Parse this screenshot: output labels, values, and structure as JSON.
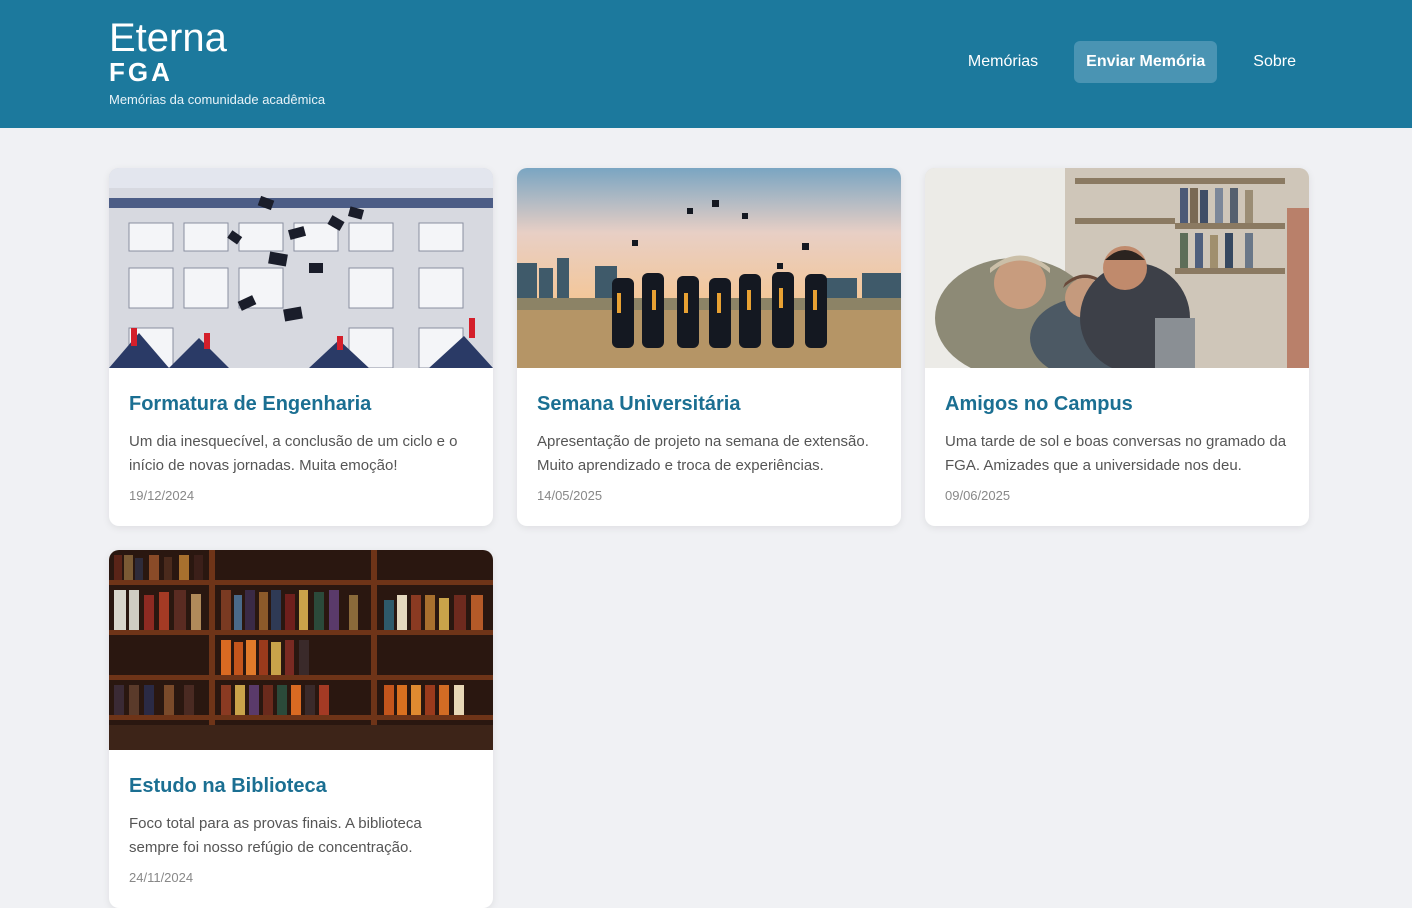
{
  "brand": {
    "title": "Eterna",
    "subtitle": "FGA",
    "tagline": "Memórias da comunidade acadêmica"
  },
  "nav": {
    "items": [
      {
        "label": "Memórias",
        "active": false
      },
      {
        "label": "Enviar Memória",
        "active": true
      },
      {
        "label": "Sobre",
        "active": false
      }
    ]
  },
  "colors": {
    "header": "#1c799d",
    "accent": "#1b6f92",
    "background": "#f0f1f4"
  },
  "cards": [
    {
      "title": "Formatura de Engenharia",
      "text": "Um dia inesquecível, a conclusão de um ciclo e o início de novas jornadas. Muita emoção!",
      "date": "19/12/2024",
      "image": "graduation-caps-building-photo"
    },
    {
      "title": "Semana Universitária",
      "text": "Apresentação de projeto na semana de extensão. Muito aprendizado e troca de experiências.",
      "date": "14/05/2025",
      "image": "graduates-sunset-photo"
    },
    {
      "title": "Amigos no Campus",
      "text": "Uma tarde de sol e boas conversas no gramado da FGA. Amizades que a universidade nos deu.",
      "date": "09/06/2025",
      "image": "friends-laptop-library-photo"
    },
    {
      "title": "Estudo na Biblioteca",
      "text": "Foco total para as provas finais. A biblioteca sempre foi nosso refúgio de concentração.",
      "date": "24/11/2024",
      "image": "bookshelf-photo"
    }
  ]
}
